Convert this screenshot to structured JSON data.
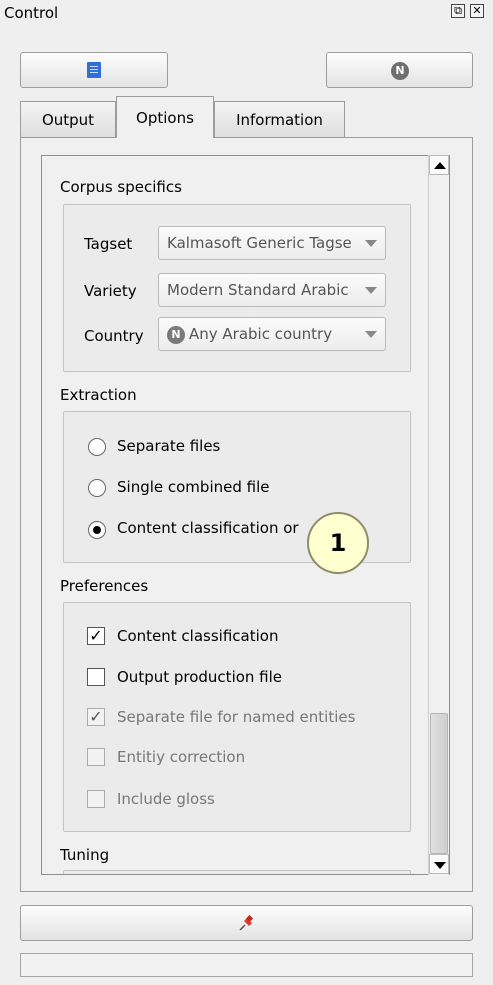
{
  "window": {
    "title": "Control",
    "float_icon": "float-icon",
    "close_icon": "close-icon"
  },
  "toolbar": {
    "left_button_icon": "document-icon",
    "right_button_icon": "N-badge-icon",
    "right_button_glyph": "N"
  },
  "tabs": [
    {
      "label": "Output",
      "active": false
    },
    {
      "label": "Options",
      "active": true
    },
    {
      "label": "Information",
      "active": false
    }
  ],
  "corpus": {
    "title": "Corpus specifics",
    "tagset_label": "Tagset",
    "tagset_value": "Kalmasoft Generic Tagse",
    "variety_label": "Variety",
    "variety_value": "Modern Standard Arabic",
    "country_label": "Country",
    "country_badge": "N",
    "country_value": "Any Arabic country"
  },
  "extraction": {
    "title": "Extraction",
    "options": [
      {
        "label": "Separate files",
        "checked": false
      },
      {
        "label": "Single combined file",
        "checked": false
      },
      {
        "label": "Content classification or",
        "checked": true
      }
    ]
  },
  "preferences": {
    "title": "Preferences",
    "options": [
      {
        "label": "Content classification",
        "checked": true,
        "enabled": true
      },
      {
        "label": "Output production file",
        "checked": false,
        "enabled": true
      },
      {
        "label": "Separate file for named entities",
        "checked": true,
        "enabled": false
      },
      {
        "label": "Entitiy correction",
        "checked": false,
        "enabled": false
      },
      {
        "label": "Include gloss",
        "checked": false,
        "enabled": false
      }
    ]
  },
  "tuning": {
    "title": "Tuning"
  },
  "bottom": {
    "pin_icon": "pin-icon"
  },
  "callout": {
    "label": "1"
  },
  "colors": {
    "callout_fill": "#ffffd0",
    "pin": "#e03a2e",
    "doc_icon": "#2f6fd6"
  }
}
